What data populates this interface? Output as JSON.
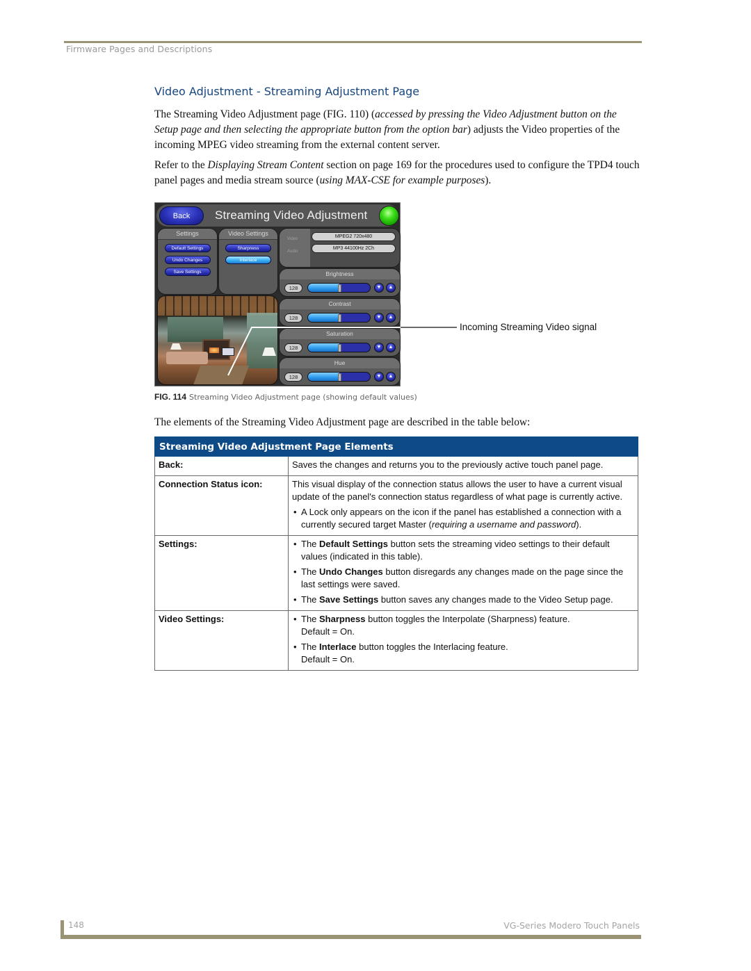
{
  "header": {
    "running_head": "Firmware Pages and Descriptions"
  },
  "section": {
    "title": "Video Adjustment - Streaming Adjustment Page",
    "para1": {
      "t1": "The Streaming Video Adjustment page (FIG. 110) (",
      "i1": "accessed by pressing the Video Adjustment button on the Setup page and then selecting the appropriate button from the option bar",
      "t2": ") adjusts the Video properties of the incoming MPEG video streaming from the external content server."
    },
    "para2": {
      "t1": "Refer to the ",
      "i1": "Displaying Stream Content",
      "t2": " section on page 169 for the procedures used to configure the TPD4 touch panel pages and media stream source (",
      "i2": "using MAX-CSE for example purposes",
      "t3": ")."
    },
    "para3": "The elements of the Streaming Video Adjustment page are described in the table below:"
  },
  "figure": {
    "panel": {
      "back_label": "Back",
      "title": "Streaming Video Adjustment",
      "status_icon": "connection-status-green",
      "status_color": "#22c20a",
      "settings": {
        "header": "Settings",
        "buttons": [
          "Default Settings",
          "Undo Changes",
          "Save Settings"
        ]
      },
      "video_settings": {
        "header": "Video Settings",
        "buttons": [
          {
            "label": "Sharpness",
            "active": false
          },
          {
            "label": "Interlace",
            "active": true
          }
        ]
      },
      "stream_info": {
        "video_label": "Video",
        "video_value": "MPEG2 720x480",
        "audio_label": "Audio",
        "audio_value": "MP3 44100Hz 2Ch"
      },
      "adjustments": [
        {
          "label": "Brightness",
          "value": "128",
          "level_percent": 50
        },
        {
          "label": "Contrast",
          "value": "128",
          "level_percent": 50
        },
        {
          "label": "Saturation",
          "value": "128",
          "level_percent": 50
        },
        {
          "label": "Hue",
          "value": "128",
          "level_percent": 50
        }
      ],
      "arrow_down": "▼",
      "arrow_up": "▲"
    },
    "callout": "Incoming Streaming Video signal",
    "caption_num": "FIG. 114",
    "caption_text": "Streaming Video Adjustment page (showing default values)"
  },
  "table": {
    "title": "Streaming Video Adjustment Page Elements",
    "rows": [
      {
        "term": "Back:",
        "desc": "Saves the changes and returns you to the previously active touch panel page."
      },
      {
        "term": "Connection Status icon:",
        "desc": "This visual display of the connection status allows the user to have a current visual update of the panel's connection status regardless of what page is currently active.",
        "bullet1": "A Lock only appears on the icon if the panel has established a connection with a currently secured target Master (",
        "bullet1_italic": "requiring a username and password",
        "bullet1_end": ")."
      },
      {
        "term": "Settings:",
        "bullets": [
          {
            "pre": "The ",
            "bold": "Default Settings",
            "post": " button sets the streaming video settings to their default values (indicated in this table)."
          },
          {
            "pre": "The ",
            "bold": "Undo Changes",
            "post": " button disregards any changes made on the page since the last settings were saved."
          },
          {
            "pre": "The ",
            "bold": "Save Settings",
            "post": " button saves any changes made to the Video Setup page."
          }
        ]
      },
      {
        "term": "Video Settings:",
        "bullets": [
          {
            "pre": "The ",
            "bold": "Sharpness",
            "post": " button toggles the Interpolate (Sharpness) feature.",
            "line2": "Default = On."
          },
          {
            "pre": "The ",
            "bold": "Interlace",
            "post": " button toggles the Interlacing feature.",
            "line2": "Default = On."
          }
        ]
      }
    ]
  },
  "footer": {
    "page_number": "148",
    "doc_title": "VG-Series Modero Touch Panels"
  }
}
